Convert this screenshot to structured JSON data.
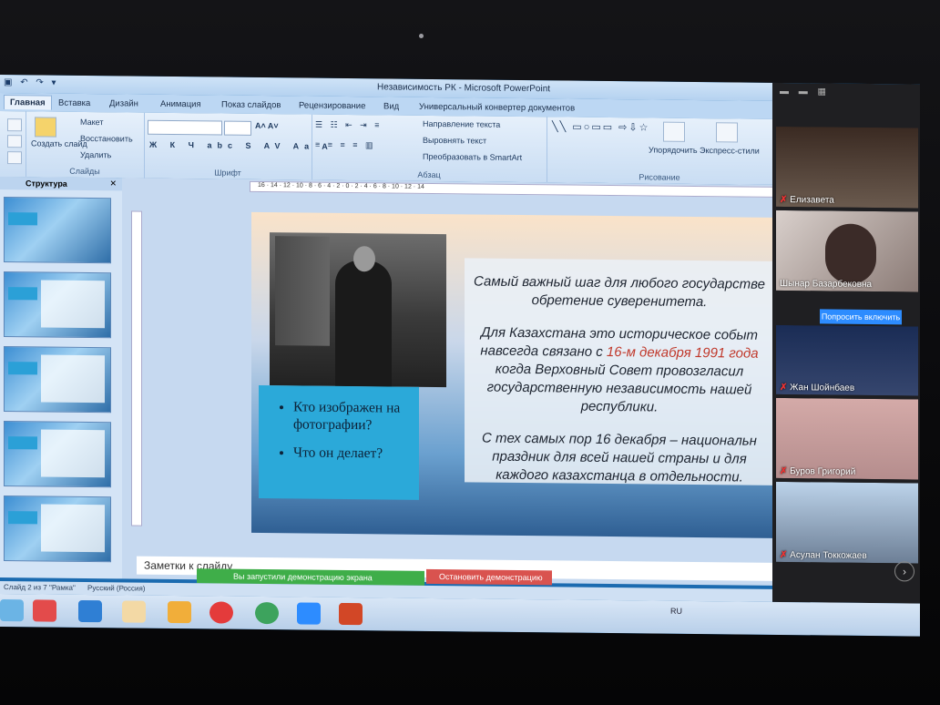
{
  "window": {
    "title": "Независимость РК - Microsoft PowerPoint"
  },
  "tabs": [
    "Главная",
    "Вставка",
    "Дизайн",
    "Анимация",
    "Показ слайдов",
    "Рецензирование",
    "Вид",
    "Универсальный конвертер документов"
  ],
  "ribbon": {
    "slides": {
      "maket": "Макет",
      "restore": "Восстановить",
      "create_slide": "Создать слайд",
      "delete": "Удалить",
      "label": "Слайды"
    },
    "font": {
      "label": "Шрифт"
    },
    "paragraph": {
      "text_dir": "Направление текста",
      "align_text": "Выровнять текст",
      "smartart": "Преобразовать в SmartArt",
      "label": "Абзац"
    },
    "drawing": {
      "arrange": "Упорядочить",
      "quick_styles": "Экспресс-стили",
      "label": "Рисование"
    }
  },
  "left_pane": {
    "tab": "Структура"
  },
  "ruler": {
    "marks": "16 · 14 · 12 · 10 · 8 · 6 · 4 · 2 · 0 · 2 · 4 · 6 · 8 · 10 · 12 · 14"
  },
  "slide": {
    "questions": [
      "Кто изображен на фотографии?",
      "Что он делает?"
    ],
    "p1": "Самый важный шаг для любого государстве обретение суверенитета.",
    "p2_a": "Для Казахстана это историческое событ навсегда связано с ",
    "p2_date": "16-м декабря 1991 года",
    "p2_b": " когда Верховный Совет провозгласил государственную независимость нашей республики.",
    "p3": "С тех самых пор 16 декабря – национальн праздник для всей нашей страны и для каждого казахстанца в отдельности."
  },
  "notes": {
    "placeholder": "Заметки к слайду"
  },
  "status": {
    "slide": "Слайд 2 из 7",
    "theme": "\"Рамка\"",
    "lang": "Русский (Россия)"
  },
  "share": {
    "banner": "Вы запустили демонстрацию экрана",
    "stop": "Остановить демонстрацию"
  },
  "participants": [
    {
      "name": "Елизавета",
      "bg": "#6a5a4e"
    },
    {
      "name": "Шынар Базарбековна",
      "bg": "#8b7b76"
    },
    {
      "name": "Жан Шойнбаев",
      "bg": "#1a2c55"
    },
    {
      "name": "Буров Григорий",
      "bg": "#c9a0a0"
    },
    {
      "name": "Асулан Токкожаев",
      "bg": "#6d7f96"
    }
  ],
  "zoom": {
    "ask_button": "Попросить включить"
  },
  "tray": {
    "lang": "RU"
  }
}
